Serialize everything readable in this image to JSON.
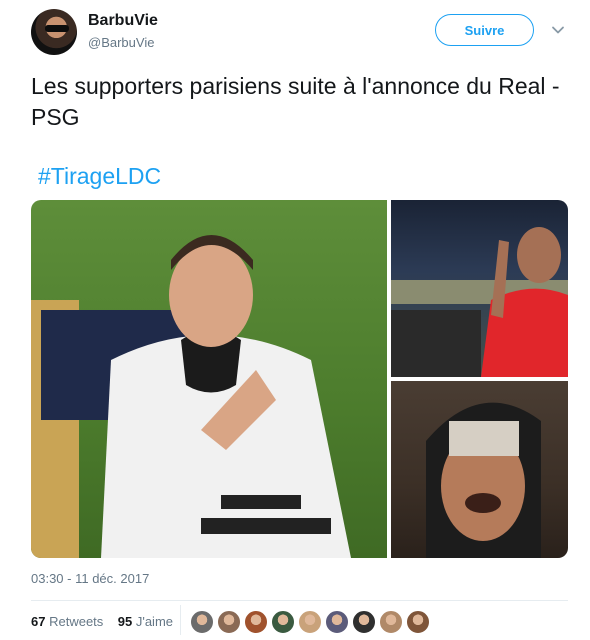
{
  "tweet": {
    "author_name": "BarbuVie",
    "author_handle": "@BarbuVie",
    "follow_label": "Suivre",
    "text": "Les supporters parisiens suite à l'annonce du Real - PSG",
    "hashtag": "#TirageLDC",
    "timestamp": "03:30 - 11 déc. 2017",
    "retweets_count": "67",
    "retweets_label": "Retweets",
    "likes_count": "95",
    "likes_label": "J'aime"
  },
  "colors": {
    "accent": "#1da1f2",
    "text": "#14171a",
    "muted": "#657786",
    "border": "#e6ecf0"
  },
  "icons": [
    "chevron-down-icon"
  ],
  "likers": [
    {
      "color": "#6b6b6b"
    },
    {
      "color": "#8a6a55"
    },
    {
      "color": "#a0522d"
    },
    {
      "color": "#3a5a40"
    },
    {
      "color": "#c9a27a"
    },
    {
      "color": "#5b5b7a"
    },
    {
      "color": "#2f2f2f"
    },
    {
      "color": "#b08968"
    },
    {
      "color": "#7f5539"
    }
  ]
}
